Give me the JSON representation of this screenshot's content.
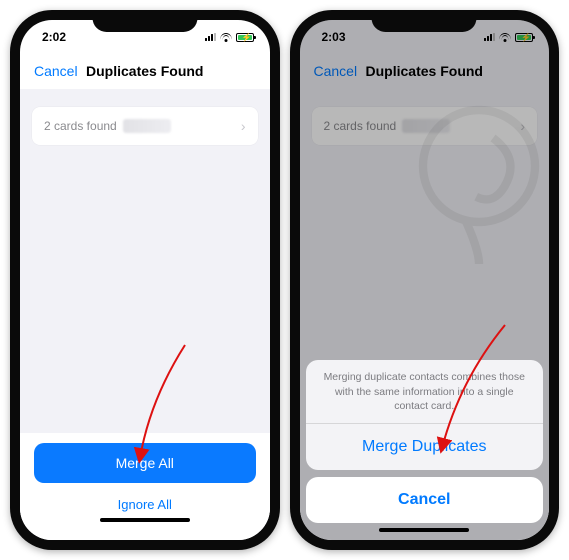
{
  "phone1": {
    "status": {
      "time": "2:02"
    },
    "nav": {
      "cancel": "Cancel",
      "title": "Duplicates Found"
    },
    "list": {
      "row_label": "2 cards found"
    },
    "actions": {
      "primary": "Merge All",
      "secondary": "Ignore All"
    }
  },
  "phone2": {
    "status": {
      "time": "2:03"
    },
    "nav": {
      "cancel": "Cancel",
      "title": "Duplicates Found"
    },
    "list": {
      "row_label": "2 cards found"
    },
    "sheet": {
      "message": "Merging duplicate contacts combines those with the same information into a single contact card.",
      "merge": "Merge Duplicates",
      "cancel": "Cancel"
    }
  }
}
